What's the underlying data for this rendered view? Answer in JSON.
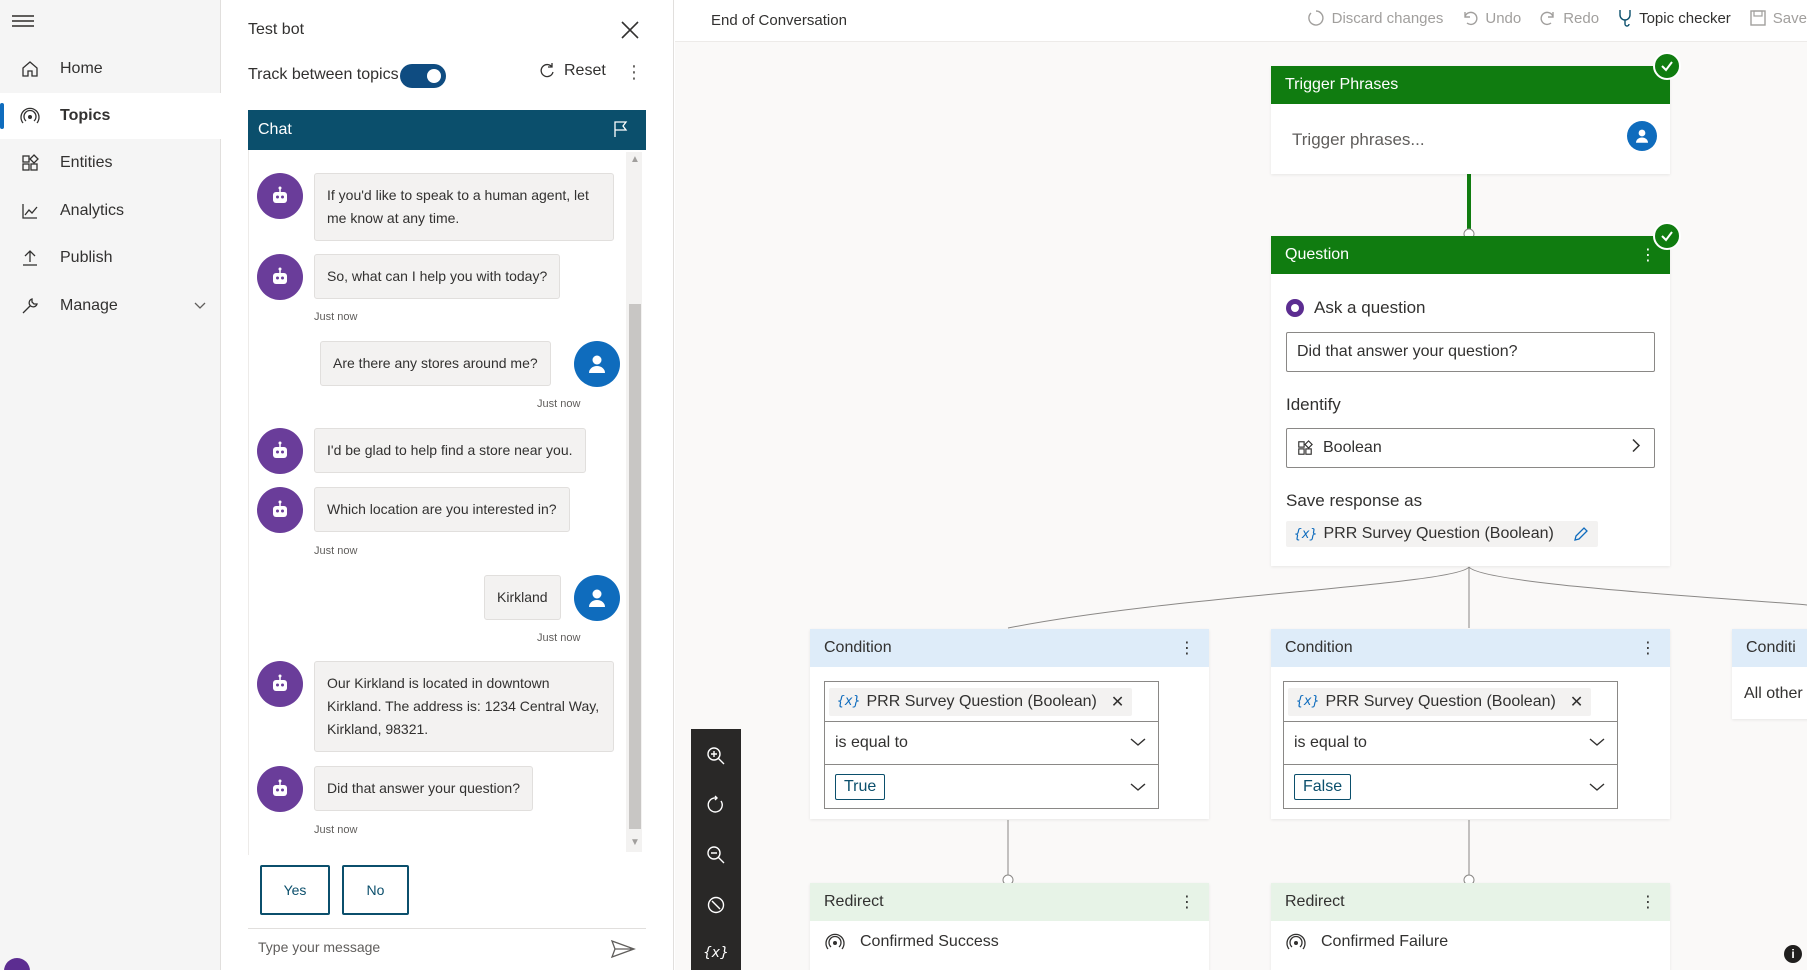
{
  "nav": {
    "items": [
      {
        "label": "Home",
        "icon": "home-icon"
      },
      {
        "label": "Topics",
        "icon": "topics-icon"
      },
      {
        "label": "Entities",
        "icon": "entities-icon"
      },
      {
        "label": "Analytics",
        "icon": "analytics-icon"
      },
      {
        "label": "Publish",
        "icon": "publish-icon"
      },
      {
        "label": "Manage",
        "icon": "wrench-icon"
      }
    ],
    "active": "Topics"
  },
  "testbot": {
    "title": "Test bot",
    "track_label": "Track between topics",
    "track_on": true,
    "reset_label": "Reset",
    "chat_label": "Chat",
    "messages": [
      {
        "from": "bot",
        "text": "If you'd like to speak to a human agent, let me know at any time."
      },
      {
        "from": "bot",
        "text": "So, what can I help you with today?",
        "time": "Just now"
      },
      {
        "from": "user",
        "text": "Are there any stores around me?",
        "time": "Just now"
      },
      {
        "from": "bot",
        "text": "I'd be glad to help find a store near you."
      },
      {
        "from": "bot",
        "text": "Which location are you interested in?",
        "time": "Just now"
      },
      {
        "from": "user",
        "text": "Kirkland",
        "time": "Just now"
      },
      {
        "from": "bot",
        "text": "Our Kirkland is located in downtown Kirkland. The address is: 1234 Central Way, Kirkland, 98321."
      },
      {
        "from": "bot",
        "text": "Did that answer your question?",
        "time": "Just now"
      }
    ],
    "choices": [
      "Yes",
      "No"
    ],
    "input_placeholder": "Type your message"
  },
  "canvas": {
    "topic_title": "End of Conversation",
    "actions": {
      "discard": "Discard changes",
      "undo": "Undo",
      "redo": "Redo",
      "checker": "Topic checker",
      "save": "Save"
    },
    "trigger": {
      "title": "Trigger Phrases",
      "placeholder": "Trigger phrases..."
    },
    "question": {
      "title": "Question",
      "ask_label": "Ask a question",
      "prompt": "Did that answer your question?",
      "identify_label": "Identify",
      "identify_value": "Boolean",
      "save_label": "Save response as",
      "variable": "PRR Survey Question (Boolean)"
    },
    "conditions": [
      {
        "title": "Condition",
        "variable": "PRR Survey Question (Boolean)",
        "operator": "is equal to",
        "value": "True"
      },
      {
        "title": "Condition",
        "variable": "PRR Survey Question (Boolean)",
        "operator": "is equal to",
        "value": "False"
      },
      {
        "title": "Conditi",
        "other": "All other"
      }
    ],
    "redirects": [
      {
        "title": "Redirect",
        "target": "Confirmed Success"
      },
      {
        "title": "Redirect",
        "target": "Confirmed Failure"
      }
    ],
    "var_symbol": "{x}",
    "info": "i"
  },
  "colors": {
    "green": "#107c10",
    "chat_header": "#0b4f6c",
    "bot_avatar": "#6a3d9a",
    "user_avatar": "#0f6cbd"
  }
}
